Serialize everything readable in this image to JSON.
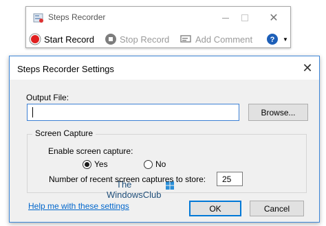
{
  "recorder": {
    "title": "Steps Recorder",
    "toolbar": {
      "start_record": "Start Record",
      "stop_record": "Stop Record",
      "add_comment": "Add Comment"
    }
  },
  "dialog": {
    "title": "Steps Recorder Settings",
    "output_file_label": "Output File:",
    "output_file_value": "",
    "browse_label": "Browse...",
    "screen_capture_group": "Screen Capture",
    "enable_capture_label": "Enable screen capture:",
    "radio_yes": "Yes",
    "radio_no": "No",
    "selected_radio": "Yes",
    "recent_count_label": "Number of recent screen captures to store:",
    "recent_count_value": "25",
    "help_link": "Help me with these settings",
    "ok_label": "OK",
    "cancel_label": "Cancel"
  },
  "watermark": {
    "line1": "The",
    "line2": "WindowsClub"
  },
  "colors": {
    "accent": "#0078d7",
    "record_red": "#e02020",
    "link": "#0066cc"
  }
}
